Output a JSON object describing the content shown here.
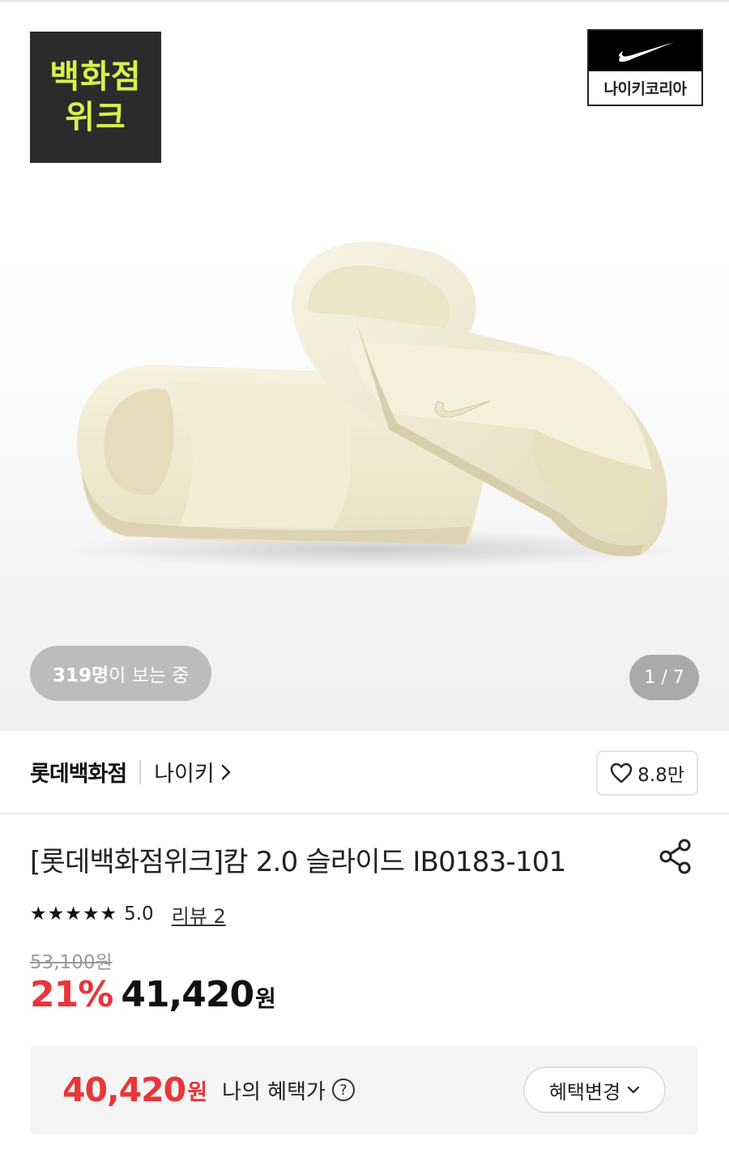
{
  "hero": {
    "badge_line1": "백화점",
    "badge_line2": "위크",
    "brand_logo_text": "나이키코리아",
    "viewers_count": "319명",
    "viewers_suffix": "이 보는 중",
    "page_counter": "1 / 7"
  },
  "store": {
    "name": "롯데백화점",
    "brand": "나이키",
    "likes": "8.8만"
  },
  "product": {
    "title": "[롯데백화점위크]캄 2.0 슬라이드 IB0183-101",
    "stars": "★★★★★",
    "rating": "5.0",
    "rating_value": 5.0,
    "rating_max": 5,
    "review_link": "리뷰 2",
    "original_price": "53,100원",
    "discount": "21%",
    "sale_price": "41,420",
    "sale_unit": "원"
  },
  "benefit": {
    "price": "40,420",
    "unit": "원",
    "label": "나의 혜택가",
    "help": "?",
    "change_button": "혜택변경"
  },
  "colors": {
    "accent_red": "#e8363a",
    "badge_bg": "#2b2b2b",
    "badge_text": "#d7f24a",
    "slide_color": "#f0ead3"
  }
}
